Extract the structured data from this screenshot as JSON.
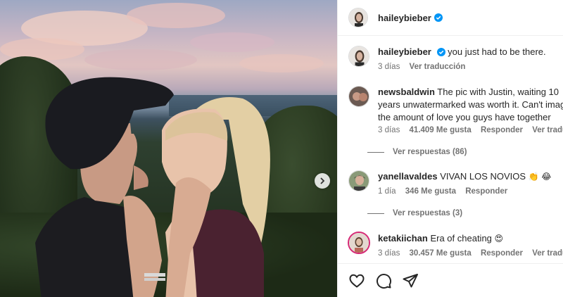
{
  "post": {
    "author": "haileybieber",
    "verified": true,
    "caption": "you just had to be there.",
    "caption_time": "3 días",
    "caption_translate": "Ver traducción"
  },
  "comments": [
    {
      "user": "newsbaldwin",
      "text": "The pic with Justin, waiting 10 years unwatermarked was worth it. Can't imagine the amount of love you guys have together",
      "time": "3 días",
      "likes": "41.409 Me gusta",
      "reply": "Responder",
      "translate": "Ver traducción",
      "replies_label": "Ver respuestas (86)"
    },
    {
      "user": "yanellavaldes",
      "text": "VIVAN LOS NOVIOS",
      "emoji": "👏 😂",
      "time": "1 día",
      "likes": "346 Me gusta",
      "reply": "Responder",
      "replies_label": "Ver respuestas (3)"
    },
    {
      "user": "ketakiichan",
      "text": "Era of cheating",
      "emoji": "😍",
      "time": "3 días",
      "likes": "30.457 Me gusta",
      "reply": "Responder",
      "translate": "Ver traducción"
    }
  ],
  "icons": {
    "like": "heart-icon",
    "comment": "comment-icon",
    "share": "share-icon",
    "next": "chevron-right-icon",
    "verified": "verified-badge-icon"
  },
  "colors": {
    "verified_blue": "#0095f6",
    "text": "#262626",
    "secondary": "#737373"
  }
}
